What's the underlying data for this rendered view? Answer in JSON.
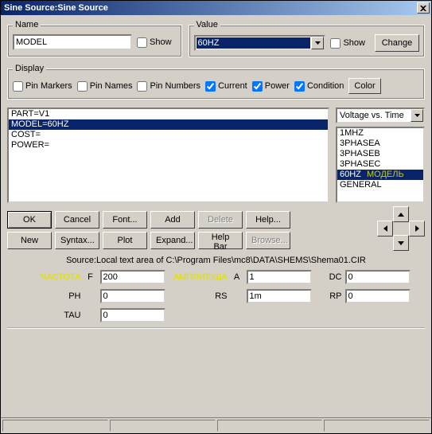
{
  "title": "Sine Source:Sine Source",
  "name_group": {
    "legend": "Name",
    "value": "MODEL",
    "show_label": "Show"
  },
  "value_group": {
    "legend": "Value",
    "selected": "60HZ",
    "show_label": "Show",
    "change_label": "Change"
  },
  "display_group": {
    "legend": "Display",
    "pin_markers": "Pin Markers",
    "pin_names": "Pin Names",
    "pin_numbers": "Pin Numbers",
    "current": "Current",
    "power": "Power",
    "condition": "Condition",
    "color_label": "Color",
    "checks": {
      "pin_markers": false,
      "pin_names": false,
      "pin_numbers": false,
      "current": true,
      "power": true,
      "condition": true
    }
  },
  "attr_list": {
    "items": [
      "PART=V1",
      "MODEL=60HZ",
      "COST=",
      "POWER="
    ],
    "selected_index": 1
  },
  "plot_combo": {
    "selected": "Voltage vs. Time"
  },
  "model_list": {
    "items": [
      "1MHZ",
      "3PHASEA",
      "3PHASEB",
      "3PHASEC",
      "60HZ",
      "GENERAL"
    ],
    "selected_index": 4,
    "selected_tag": "МОДЕЛЬ"
  },
  "buttons": {
    "ok": "OK",
    "cancel": "Cancel",
    "font": "Font...",
    "add": "Add",
    "delete": "Delete",
    "help": "Help...",
    "new": "New",
    "syntax": "Syntax...",
    "plot": "Plot",
    "expand": "Expand...",
    "helpbar": "Help Bar",
    "browse": "Browse..."
  },
  "source_line": "Source:Local text area of C:\\Program Files\\mc8\\DATA\\SHEMS\\Shema01.CIR",
  "params": {
    "labels": {
      "freq": "ЧАСТОТА",
      "freq_sym": "F",
      "amp": "АМПЛИТУДА",
      "amp_sym": "A",
      "dc": "DC",
      "ph": "PH",
      "rs": "RS",
      "rp": "RP",
      "tau": "TAU"
    },
    "values": {
      "freq": "200",
      "amp": "1",
      "dc": "0",
      "ph": "0",
      "rs": "1m",
      "rp": "0",
      "tau": "0"
    }
  }
}
